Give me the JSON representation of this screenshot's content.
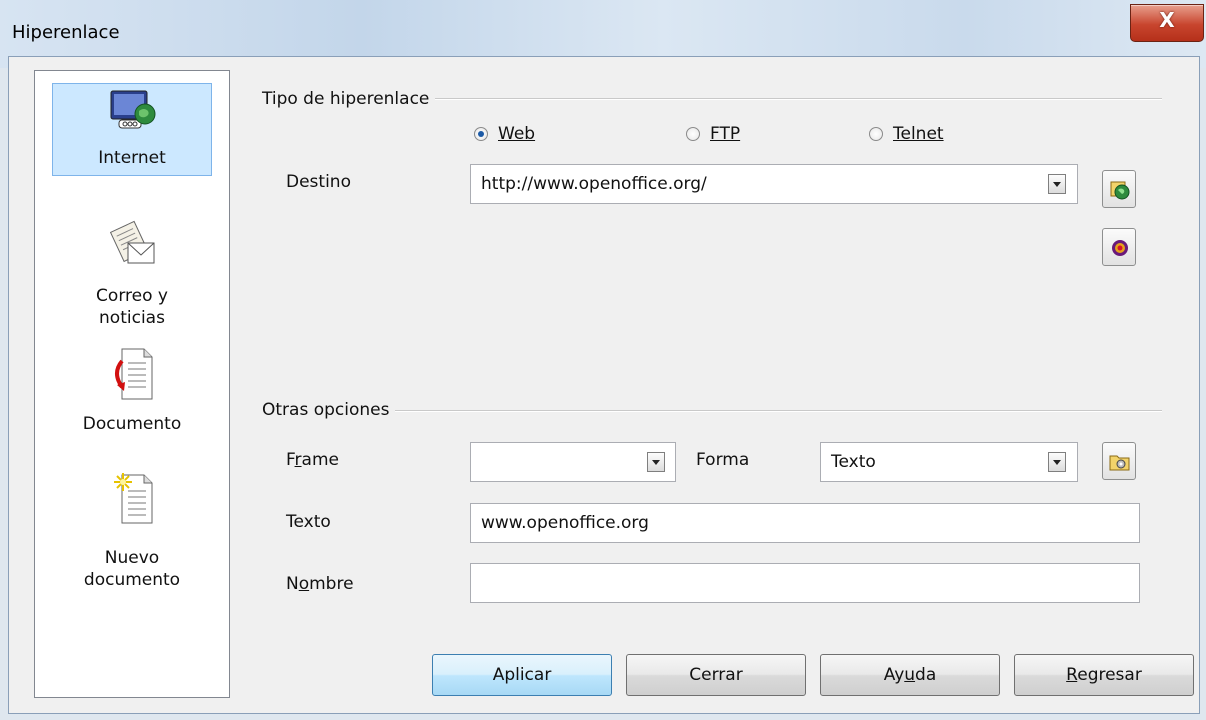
{
  "window": {
    "title": "Hiperenlace",
    "close_glyph": "X"
  },
  "categories": [
    {
      "label": "Internet",
      "icon": "internet-globe-icon",
      "selected": true
    },
    {
      "label": "Correo y noticias",
      "icon": "mail-news-icon",
      "selected": false
    },
    {
      "label": "Documento",
      "icon": "document-icon",
      "selected": false
    },
    {
      "label": "Nuevo documento",
      "icon": "new-document-icon",
      "selected": false
    }
  ],
  "hyperlink_type": {
    "title": "Tipo de hiperenlace",
    "options": [
      {
        "label": "Web",
        "selected": true
      },
      {
        "label": "FTP",
        "selected": false
      },
      {
        "label": "Telnet",
        "selected": false
      }
    ],
    "target_label": "Destino",
    "target_value": "http://www.openoffice.org/"
  },
  "other_options": {
    "title": "Otras opciones",
    "frame_label": "Frame",
    "frame_value": "",
    "form_label": "Forma",
    "form_value": "Texto",
    "text_label": "Texto",
    "text_value": "www.openoffice.org",
    "name_label": "Nombre",
    "name_value": ""
  },
  "buttons": {
    "apply": "Aplicar",
    "close": "Cerrar",
    "help": "Ayuda",
    "back": "Regresar"
  },
  "colors": {
    "accent": "#3c7fb1",
    "selection": "#cce8ff",
    "close_button": "#c8452e"
  }
}
